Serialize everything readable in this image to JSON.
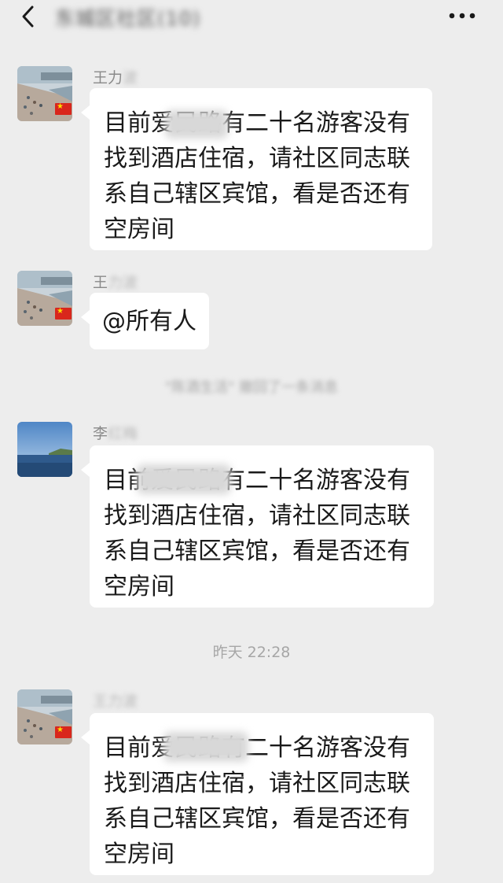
{
  "header": {
    "title": "东城区社区(10)"
  },
  "messages": [
    {
      "sender": "王力",
      "sender_hidden": "波",
      "text": "目前爱民路有二十名游客没有\n找到酒店住宿，请社区同志联\n系自己辖区宾馆，看是否还有\n空房间"
    },
    {
      "sender": "王",
      "sender_hidden": "力波",
      "text": "@所有人"
    },
    {
      "sender": "李",
      "sender_hidden": "红梅",
      "text": "目前爱民路有二十名游客没有\n找到酒店住宿，请社区同志联\n系自己辖区宾馆，看是否还有\n空房间"
    },
    {
      "sender": "",
      "sender_hidden": "王力波",
      "text": "目前爱民路有二十名游客没有\n找到酒店住宿，请社区同志联\n系自己辖区宾馆，看是否还有\n空房间"
    }
  ],
  "system": {
    "recall_notice": "\"陈酒生活\" 撤回了一条消息"
  },
  "timestamp": "昨天 22:28"
}
